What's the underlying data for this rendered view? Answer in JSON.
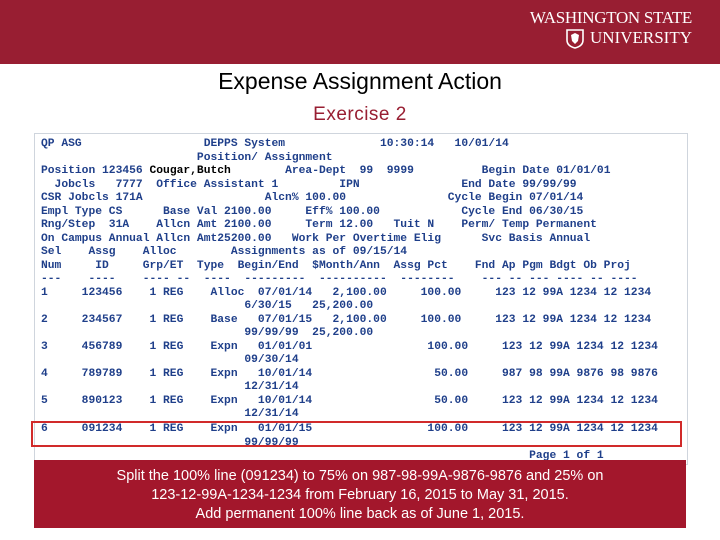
{
  "logo": {
    "line1": "WASHINGTON STATE",
    "line2": "UNIVERSITY"
  },
  "title": "Expense Assignment Action",
  "subtitle": "Exercise 2",
  "screen": {
    "lines": [
      {
        "text": "QP ASG                  DEPPS System              10:30:14   10/01/14",
        "color": "blue"
      },
      {
        "text": "                       Position/ Assignment",
        "color": "blue"
      },
      {
        "text": "Position 123456",
        "color": "blue",
        "inline_label": " Cougar,Butch",
        "rest": "        Area-Dept  99  9999          Begin Date 01/01/01"
      },
      {
        "text": "  Jobcls   7777  Office Assistant 1         IPN               End Date 99/99/99",
        "color": "blue"
      },
      {
        "text": "CSR Jobcls 171A                  Alcn% 100.00               Cycle Begin 07/01/14",
        "color": "blue"
      },
      {
        "text": "Empl Type CS      Base Val 2100.00     Eff% 100.00            Cycle End 06/30/15",
        "color": "blue"
      },
      {
        "text": "Rng/Step  31A    Allcn Amt 2100.00     Term 12.00   Tuit N    Perm/ Temp Permanent",
        "color": "blue"
      },
      {
        "text": "On Campus Annual Allcn Amt25200.00   Work Per Overtime Elig      Svc Basis Annual",
        "color": "blue"
      },
      {
        "text": "Sel    Assg    Alloc        Assignments as of 09/15/14",
        "color": "blue"
      },
      {
        "text": "Num     ID     Grp/ET  Type  Begin/End  $Month/Ann  Assg Pct    Fnd Ap Pgm Bdgt Ob Proj",
        "color": "blue"
      },
      {
        "text": "---    ----    ---- --  ----  ---------  ----------  --------    --- -- --- ---- -- ----",
        "color": "blue"
      },
      {
        "text": "1     123456    1 REG    Alloc  07/01/14   2,100.00     100.00     123 12 99A 1234 12 1234",
        "color": "blue"
      },
      {
        "text": "                              6/30/15   25,200.00",
        "color": "blue"
      },
      {
        "text": "2     234567    1 REG    Base   07/01/15   2,100.00     100.00     123 12 99A 1234 12 1234",
        "color": "blue"
      },
      {
        "text": "                              99/99/99  25,200.00",
        "color": "blue"
      },
      {
        "text": "3     456789    1 REG    Expn   01/01/01                 100.00     123 12 99A 1234 12 1234",
        "color": "blue"
      },
      {
        "text": "                              09/30/14",
        "color": "blue"
      },
      {
        "text": "4     789789    1 REG    Expn   10/01/14                  50.00     987 98 99A 9876 98 9876",
        "color": "blue"
      },
      {
        "text": "                              12/31/14",
        "color": "blue"
      },
      {
        "text": "5     890123    1 REG    Expn   10/01/14                  50.00     123 12 99A 1234 12 1234",
        "color": "blue"
      },
      {
        "text": "                              12/31/14",
        "color": "blue"
      },
      {
        "text": "6     091234    1 REG    Expn   01/01/15                 100.00     123 12 99A 1234 12 1234",
        "color": "blue"
      },
      {
        "text": "                              99/99/99",
        "color": "blue"
      },
      {
        "text": "                                                                        Page 1 of 1",
        "color": "blue"
      }
    ]
  },
  "highlight_row": "6",
  "caption": {
    "line1": "Split the 100% line (091234) to 75% on 987-98-99A-9876-9876 and 25% on",
    "line2": "123-12-99A-1234-1234 from February 16, 2015 to May 31, 2015.",
    "line3": "Add permanent 100% line back as of June 1, 2015."
  },
  "colors": {
    "brand": "#981e32",
    "terminal_text": "#1f3f8a",
    "highlight": "#d12a2a"
  }
}
